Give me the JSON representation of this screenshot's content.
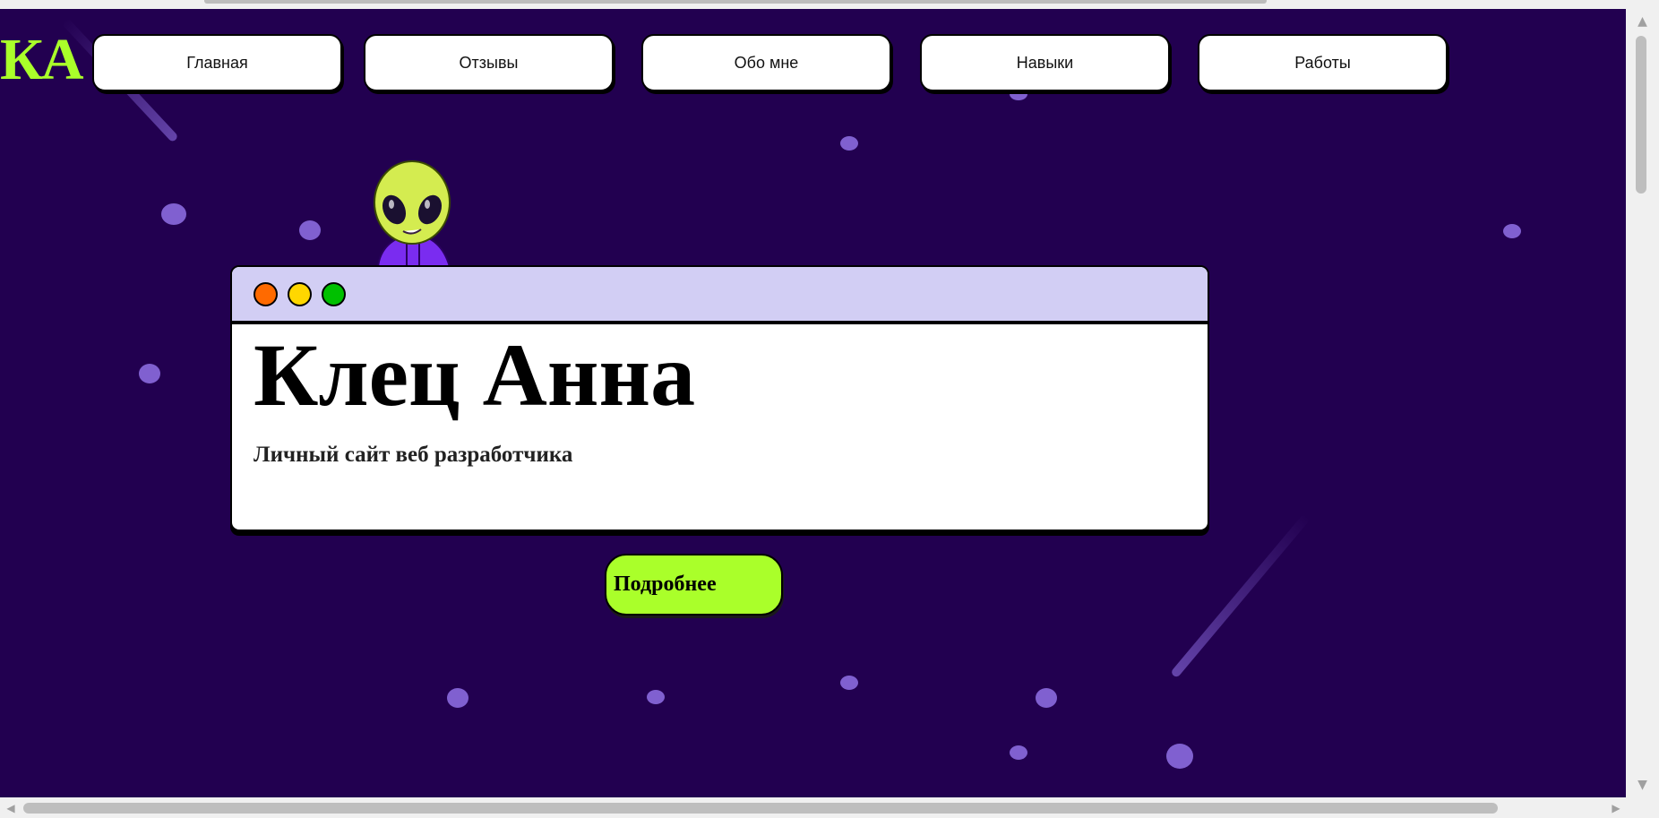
{
  "logo": {
    "text": "КА"
  },
  "nav": {
    "items": [
      {
        "label": "Главная"
      },
      {
        "label": "Отзывы"
      },
      {
        "label": "Обо мне"
      },
      {
        "label": "Навыки"
      },
      {
        "label": "Работы"
      }
    ]
  },
  "hero": {
    "title": "Клец Анна",
    "subtitle": "Личный сайт веб разработчика",
    "button_label": "Подробнее"
  },
  "window_controls": [
    {
      "name": "close",
      "color": "#ff6a00"
    },
    {
      "name": "minimize",
      "color": "#ffd700"
    },
    {
      "name": "maximize",
      "color": "#00c000"
    }
  ],
  "colors": {
    "background": "#220050",
    "accent": "#aaff2a",
    "window_bar": "#d2cef4",
    "stars": "#8060d0"
  },
  "scrollbars": {
    "up_arrow_icon": "▲",
    "down_arrow_icon": "▼",
    "left_arrow_icon": "◀",
    "right_arrow_icon": "▶"
  }
}
